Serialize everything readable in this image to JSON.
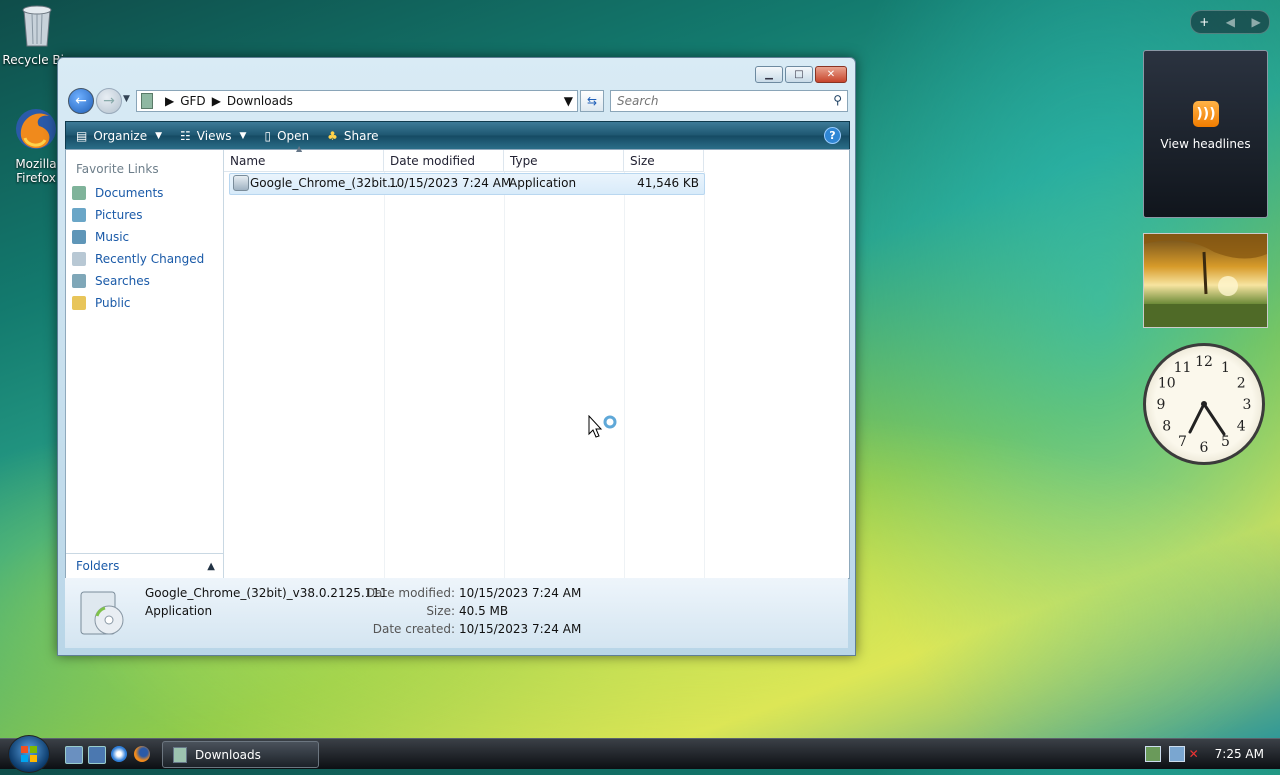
{
  "desktop": {
    "icons": [
      {
        "label": "Recycle Bin",
        "icon": "recycle-bin-icon"
      },
      {
        "label": "Mozilla Firefox",
        "icon": "firefox-icon"
      }
    ]
  },
  "window": {
    "address": {
      "crumbs": [
        "GFD",
        "Downloads"
      ]
    },
    "search_placeholder": "Search",
    "toolbar": {
      "organize": "Organize",
      "views": "Views",
      "open": "Open",
      "share": "Share"
    },
    "nav": {
      "title": "Favorite Links",
      "items": [
        {
          "label": "Documents",
          "icon": "documents-icon"
        },
        {
          "label": "Pictures",
          "icon": "pictures-icon"
        },
        {
          "label": "Music",
          "icon": "music-icon"
        },
        {
          "label": "Recently Changed",
          "icon": "recently-changed-icon"
        },
        {
          "label": "Searches",
          "icon": "searches-icon"
        },
        {
          "label": "Public",
          "icon": "public-folder-icon"
        }
      ],
      "folders_label": "Folders"
    },
    "columns": [
      "Name",
      "Date modified",
      "Type",
      "Size"
    ],
    "files": [
      {
        "name": "Google_Chrome_(32bit...",
        "date": "10/15/2023 7:24 AM",
        "type": "Application",
        "size": "41,546 KB"
      }
    ],
    "details": {
      "name": "Google_Chrome_(32bit)_v38.0.2125.111",
      "type": "Application",
      "modified_label": "Date modified:",
      "modified": "10/15/2023 7:24 AM",
      "size_label": "Size:",
      "size": "40.5 MB",
      "created_label": "Date created:",
      "created": "10/15/2023 7:24 AM"
    }
  },
  "sidebar": {
    "rss_label": "View headlines",
    "clock_numbers": [
      "12",
      "1",
      "2",
      "3",
      "4",
      "5",
      "6",
      "7",
      "8",
      "9",
      "10",
      "11"
    ]
  },
  "taskbar": {
    "task": "Downloads",
    "time": "7:25 AM"
  }
}
